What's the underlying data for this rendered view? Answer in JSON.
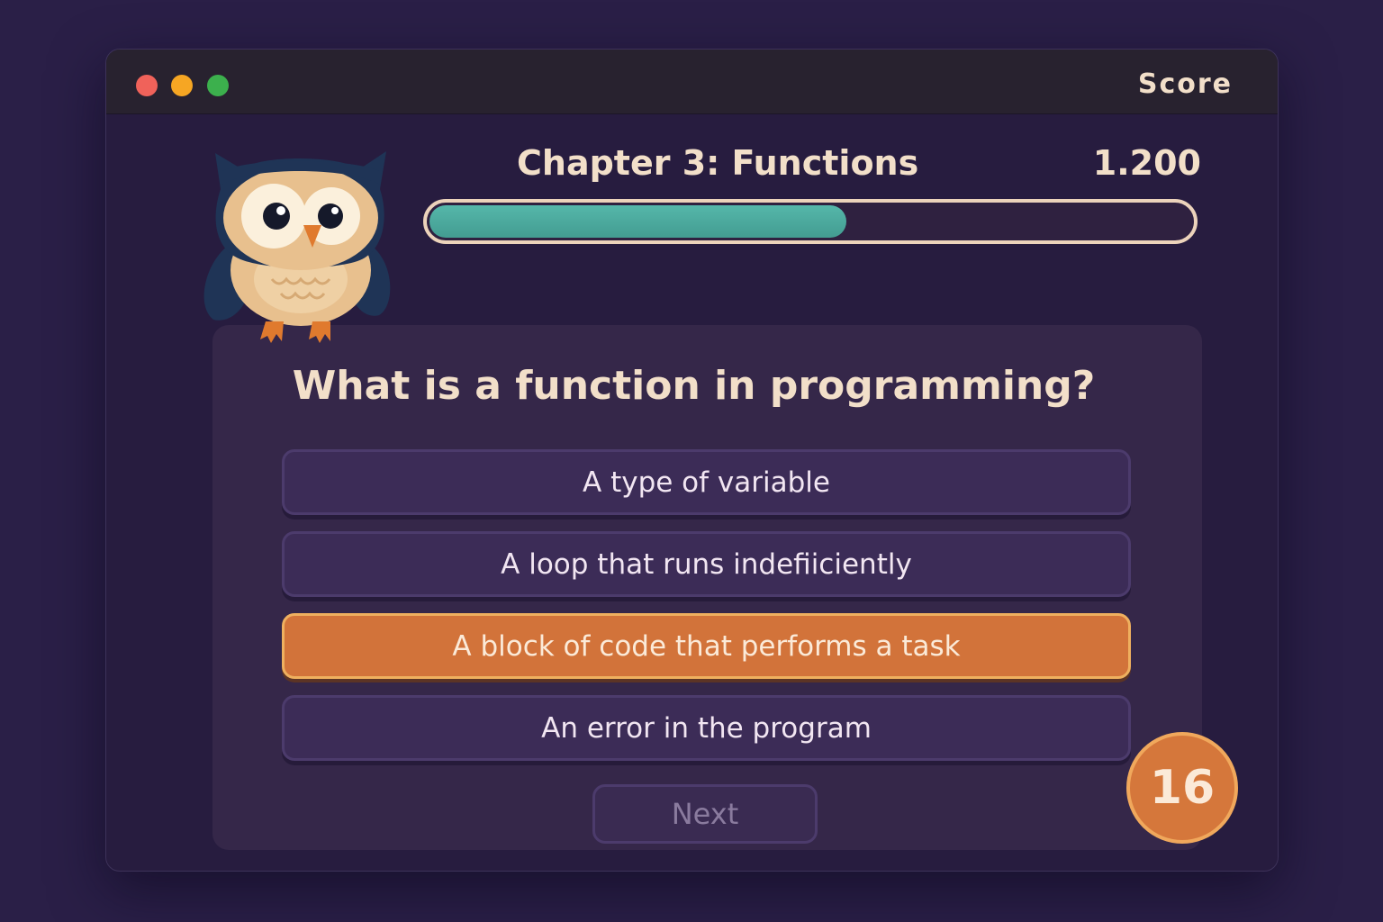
{
  "window": {
    "score_label": "Score"
  },
  "header": {
    "chapter_title": "Chapter 3: Functions",
    "points": "1.200",
    "progress": 0.55
  },
  "quiz": {
    "question": "What is a function in programming?",
    "options": [
      {
        "label": "A type of variable",
        "selected": false
      },
      {
        "label": "A loop that runs indefiiciently",
        "selected": false
      },
      {
        "label": "A block of code that performs a task",
        "selected": true
      },
      {
        "label": "An error in the program",
        "selected": false
      }
    ],
    "next_label": "Next"
  },
  "timer": {
    "value": "16"
  },
  "colors": {
    "accent_orange": "#d2733a",
    "progress_teal": "#4aa99d",
    "background": "#2a1f47"
  },
  "icons": [
    "owl-mascot-icon"
  ]
}
